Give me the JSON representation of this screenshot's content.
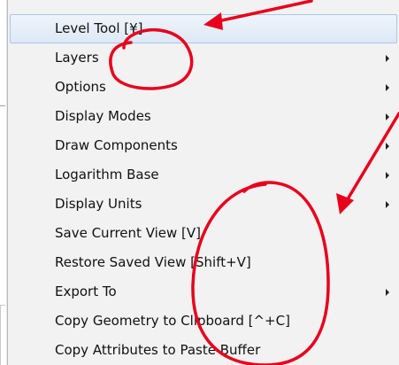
{
  "menu": {
    "items": [
      {
        "label": "Level Tool [¥]",
        "has_submenu": false,
        "highlighted": true
      },
      {
        "label": "Layers",
        "has_submenu": true
      },
      {
        "label": "Options",
        "has_submenu": true
      },
      {
        "label": "Display Modes",
        "has_submenu": true
      },
      {
        "label": "Draw Components",
        "has_submenu": true
      },
      {
        "label": "Logarithm Base",
        "has_submenu": true
      },
      {
        "label": "Display Units",
        "has_submenu": true
      },
      {
        "label": "Save Current View [V]",
        "has_submenu": false
      },
      {
        "label": "Restore Saved View [Shift+V]",
        "has_submenu": false
      },
      {
        "label": "Export To",
        "has_submenu": true
      },
      {
        "label": "Copy Geometry to Clipboard [^+C]",
        "has_submenu": false
      },
      {
        "label": "Copy Attributes to Paste Buffer",
        "has_submenu": false
      }
    ]
  },
  "annotations": {
    "color": "#e8001c"
  },
  "colors": {
    "menu_background": "#f2f2f2",
    "highlight_border": "#a9c6e8",
    "arrow": "#222222"
  }
}
